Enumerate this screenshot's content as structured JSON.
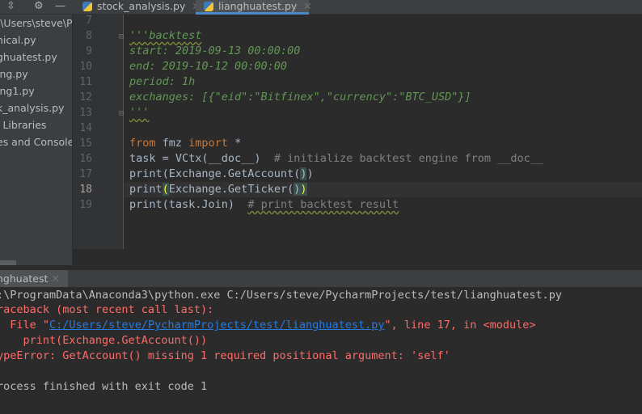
{
  "toolbar": {
    "icons": [
      "collapse-icon",
      "gear-icon",
      "minimize-icon"
    ]
  },
  "tabs": [
    {
      "label": "stock_analysis.py",
      "active": false
    },
    {
      "label": "lianghuatest.py",
      "active": true
    }
  ],
  "sidebar": {
    "items": [
      ":\\Users\\steve\\Py",
      "nical.py",
      "ghuatest.py",
      "ing.py",
      "ing1.py",
      "k_analysis.py",
      "l Libraries",
      "es and Console"
    ]
  },
  "editor": {
    "line_numbers": [
      "7",
      "8",
      "9",
      "10",
      "11",
      "12",
      "13",
      "14",
      "15",
      "16",
      "17",
      "18",
      "19"
    ],
    "lines": {
      "l8": "'''backtest",
      "l9": "start: 2019-09-13 00:00:00",
      "l10": "end: 2019-10-12 00:00:00",
      "l11": "period: 1h",
      "l12": "exchanges: [{\"eid\":\"Bitfinex\",\"currency\":\"BTC_USD\"}]",
      "l13": "'''",
      "l15a": "from",
      "l15b": " fmz ",
      "l15c": "import",
      "l15d": " *",
      "l16a": "task = VCtx(__doc__)  ",
      "l16b": "# initialize backtest engine from __doc__",
      "l17a": "print(Exchange.GetAccount(",
      "l17b": ")",
      "l17c": ")",
      "l18a": "print",
      "l18b": "(",
      "l18c": "Exchange.GetTicker(",
      "l18d": ")",
      "l18e": ")",
      "l19a": "print(task.Join)  ",
      "l19b": "# print backtest result"
    }
  },
  "run": {
    "tab_label": "nghuatest",
    "lines": {
      "cmd": ":\\ProgramData\\Anaconda3\\python.exe C:/Users/steve/PycharmProjects/test/lianghuatest.py",
      "tb": "raceback (most recent call last):",
      "file_pre": "  File \"",
      "file_link": "C:/Users/steve/PycharmProjects/test/lianghuatest.py",
      "file_post": "\", line 17, in <module>",
      "src": "    print(Exchange.GetAccount())",
      "error": "ypeError: GetAccount() missing 1 required positional argument: 'self'",
      "exit": "rocess finished with exit code 1"
    }
  },
  "colors": {
    "background": "#2b2b2b",
    "keyword": "#cc7832",
    "docstring": "#629755",
    "comment": "#808080",
    "error": "#ff6b68",
    "link": "#287bde"
  }
}
